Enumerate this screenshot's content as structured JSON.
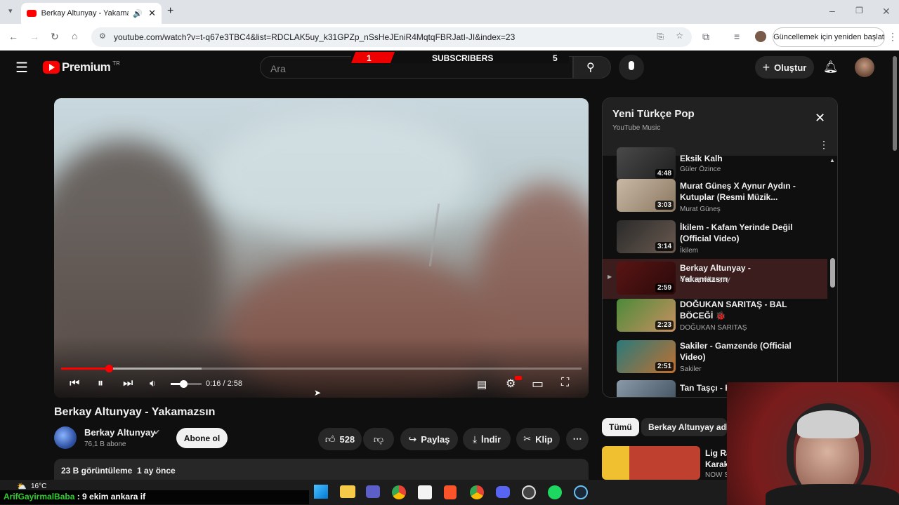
{
  "browser": {
    "tab_title": "Berkay Altunyay - Yakamazsın",
    "url": "youtube.com/watch?v=t-q67e3TBC4&list=RDCLAK5uy_k31GPZp_nSsHeJEniR4MqtqFBRJatI-JI&index=23",
    "update_button": "Güncellemek için yeniden başlat"
  },
  "youtube": {
    "logo_text": "Premium",
    "logo_badge": "TR",
    "search_placeholder": "Ara",
    "create_label": "Oluştur",
    "subscriber_counter": {
      "left_value": "1",
      "label": "SUBSCRIBERS",
      "right_value": "5"
    }
  },
  "player": {
    "time": "0:16 / 2:58",
    "progress_fraction": 0.092,
    "volume_fraction": 0.4
  },
  "video": {
    "title": "Berkay Altunyay - Yakamazsın",
    "channel": "Berkay Altunyay",
    "subscribers": "76,1 B abone",
    "subscribe_label": "Abone ol",
    "likes": "528",
    "share_label": "Paylaş",
    "download_label": "İndir",
    "clip_label": "Klip",
    "views": "23 B görüntüleme  1 ay önce"
  },
  "playlist": {
    "title": "Yeni Türkçe Pop",
    "subtitle": "YouTube Music",
    "items": [
      {
        "title": "Eksik Kalh",
        "channel": "Güler Özince",
        "duration": "4:48"
      },
      {
        "title": "Murat Güneş X Aynur Aydın - Kutuplar (Resmi Müzik...",
        "channel": "Murat Güneş",
        "duration": "3:03"
      },
      {
        "title": "İkilem - Kafam Yerinde Değil (Official Video)",
        "channel": "İkilem",
        "duration": "3:14"
      },
      {
        "title": "Berkay Altunyay - Yakamazsın",
        "channel": "Berkay Altunyay",
        "duration": "2:59"
      },
      {
        "title": "DOĞUKAN SARITAŞ - BAL BÖCEĞİ 🐞",
        "channel": "DOĞUKAN SARITAŞ",
        "duration": "2:23"
      },
      {
        "title": "Sakiler - Gamzende (Official Video)",
        "channel": "Sakiler",
        "duration": "2:51"
      },
      {
        "title": "Tan Taşçı - K...",
        "channel": "",
        "duration": ""
      }
    ]
  },
  "chips": {
    "all": "Tümü",
    "channel": "Berkay Altunyay adlı"
  },
  "side_video": {
    "title": "Lig Ra",
    "title2": "Karak",
    "channel": "NOW S"
  },
  "taskbar": {
    "weather": "16°C"
  },
  "chat": {
    "user": "ArifGayirmalBaba",
    "message": ": 9 ekim ankara if"
  }
}
